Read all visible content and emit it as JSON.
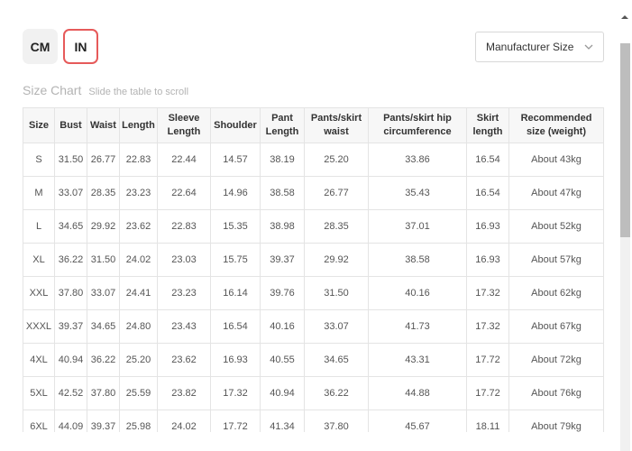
{
  "units": {
    "cm": "CM",
    "in": "IN",
    "selected": "IN"
  },
  "size_select": {
    "value": "Manufacturer Size",
    "icon": "chevron-down-icon"
  },
  "chart": {
    "title": "Size Chart",
    "hint": "Slide the table to scroll"
  },
  "table": {
    "headers": [
      [
        "Size"
      ],
      [
        "Bust"
      ],
      [
        "Waist"
      ],
      [
        "Length"
      ],
      [
        "Sleeve",
        "Length"
      ],
      [
        "Shoulder"
      ],
      [
        "Pant",
        "Length"
      ],
      [
        "Pants/skirt",
        "waist"
      ],
      [
        "Pants/skirt hip",
        "circumference"
      ],
      [
        "Skirt",
        "length"
      ],
      [
        "Recommended",
        "size (weight)"
      ]
    ],
    "rows": [
      [
        "S",
        "31.50",
        "26.77",
        "22.83",
        "22.44",
        "14.57",
        "38.19",
        "25.20",
        "33.86",
        "16.54",
        "About 43kg"
      ],
      [
        "M",
        "33.07",
        "28.35",
        "23.23",
        "22.64",
        "14.96",
        "38.58",
        "26.77",
        "35.43",
        "16.54",
        "About 47kg"
      ],
      [
        "L",
        "34.65",
        "29.92",
        "23.62",
        "22.83",
        "15.35",
        "38.98",
        "28.35",
        "37.01",
        "16.93",
        "About 52kg"
      ],
      [
        "XL",
        "36.22",
        "31.50",
        "24.02",
        "23.03",
        "15.75",
        "39.37",
        "29.92",
        "38.58",
        "16.93",
        "About 57kg"
      ],
      [
        "XXL",
        "37.80",
        "33.07",
        "24.41",
        "23.23",
        "16.14",
        "39.76",
        "31.50",
        "40.16",
        "17.32",
        "About 62kg"
      ],
      [
        "XXXL",
        "39.37",
        "34.65",
        "24.80",
        "23.43",
        "16.54",
        "40.16",
        "33.07",
        "41.73",
        "17.32",
        "About 67kg"
      ],
      [
        "4XL",
        "40.94",
        "36.22",
        "25.20",
        "23.62",
        "16.93",
        "40.55",
        "34.65",
        "43.31",
        "17.72",
        "About 72kg"
      ],
      [
        "5XL",
        "42.52",
        "37.80",
        "25.59",
        "23.82",
        "17.32",
        "40.94",
        "36.22",
        "44.88",
        "17.72",
        "About 76kg"
      ],
      [
        "6XL",
        "44.09",
        "39.37",
        "25.98",
        "24.02",
        "17.72",
        "41.34",
        "37.80",
        "45.67",
        "18.11",
        "About 79kg"
      ]
    ]
  },
  "colors": {
    "accent": "#e65a5a",
    "header_bg": "#f7f7f7",
    "border": "#e4e4e4",
    "muted": "#b3b3b3"
  }
}
